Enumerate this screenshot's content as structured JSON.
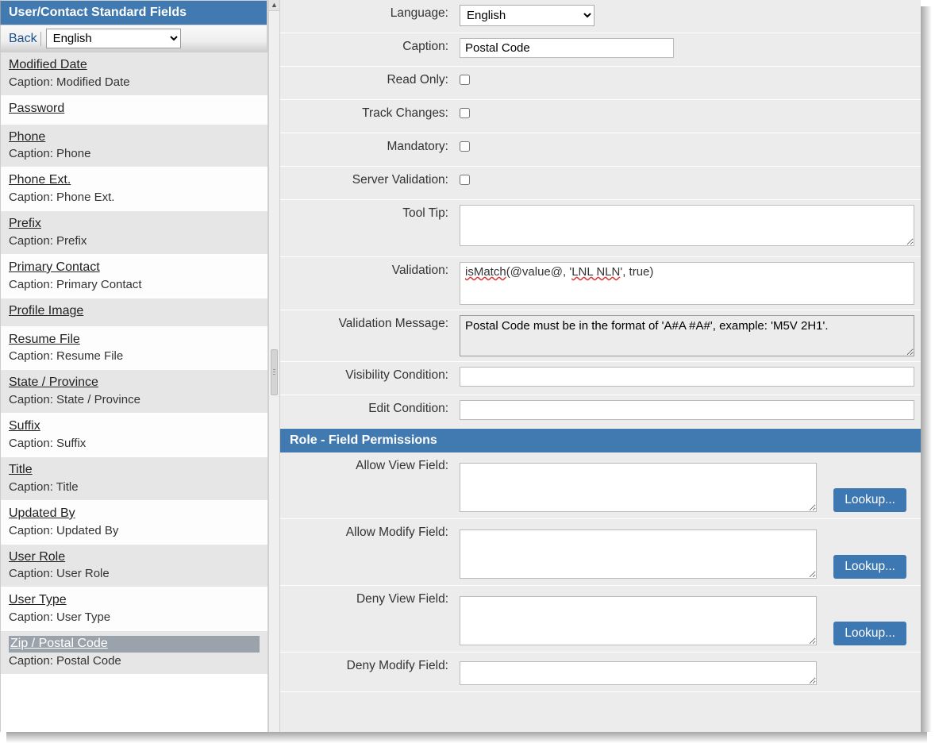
{
  "sidebar": {
    "title": "User/Contact Standard Fields",
    "back_label": "Back",
    "language": "English",
    "items": [
      {
        "name": "Modified Date",
        "caption": "Caption: Modified Date",
        "alt": true
      },
      {
        "name": "Password",
        "caption": "",
        "alt": false
      },
      {
        "name": "Phone",
        "caption": "Caption: Phone",
        "alt": true
      },
      {
        "name": "Phone Ext.",
        "caption": "Caption: Phone Ext.",
        "alt": false
      },
      {
        "name": "Prefix",
        "caption": "Caption: Prefix",
        "alt": true
      },
      {
        "name": "Primary Contact",
        "caption": "Caption: Primary Contact",
        "alt": false
      },
      {
        "name": "Profile Image",
        "caption": "",
        "alt": true
      },
      {
        "name": "Resume File",
        "caption": "Caption: Resume File",
        "alt": false
      },
      {
        "name": "State / Province",
        "caption": "Caption: State / Province",
        "alt": true
      },
      {
        "name": "Suffix",
        "caption": "Caption: Suffix",
        "alt": false
      },
      {
        "name": "Title",
        "caption": "Caption: Title",
        "alt": true
      },
      {
        "name": "Updated By",
        "caption": "Caption: Updated By",
        "alt": false
      },
      {
        "name": "User Role",
        "caption": "Caption: User Role",
        "alt": true
      },
      {
        "name": "User Type",
        "caption": "Caption: User Type",
        "alt": false
      },
      {
        "name": "Zip / Postal Code",
        "caption": "Caption: Postal Code",
        "alt": true,
        "selected": true
      }
    ]
  },
  "form": {
    "labels": {
      "language": "Language:",
      "caption": "Caption:",
      "read_only": "Read Only:",
      "track_changes": "Track Changes:",
      "mandatory": "Mandatory:",
      "server_validation": "Server Validation:",
      "tooltip": "Tool Tip:",
      "validation": "Validation:",
      "validation_message": "Validation Message:",
      "visibility_condition": "Visibility Condition:",
      "edit_condition": "Edit Condition:"
    },
    "values": {
      "language": "English",
      "caption": "Postal Code",
      "read_only": false,
      "track_changes": false,
      "mandatory": false,
      "server_validation": false,
      "tooltip": "",
      "validation_prefix": "isMatch",
      "validation_mid": "(@value@, '",
      "validation_pattern": "LNL NLN",
      "validation_suffix": "', true)",
      "validation_message": "Postal Code must be in the format of 'A#A #A#', example: 'M5V 2H1'.",
      "visibility_condition": "",
      "edit_condition": ""
    }
  },
  "permissions": {
    "title": "Role - Field Permissions",
    "lookup_label": "Lookup...",
    "labels": {
      "allow_view": "Allow View Field:",
      "allow_modify": "Allow Modify Field:",
      "deny_view": "Deny View Field:",
      "deny_modify": "Deny Modify Field:"
    },
    "values": {
      "allow_view": "",
      "allow_modify": "",
      "deny_view": "",
      "deny_modify": ""
    }
  }
}
